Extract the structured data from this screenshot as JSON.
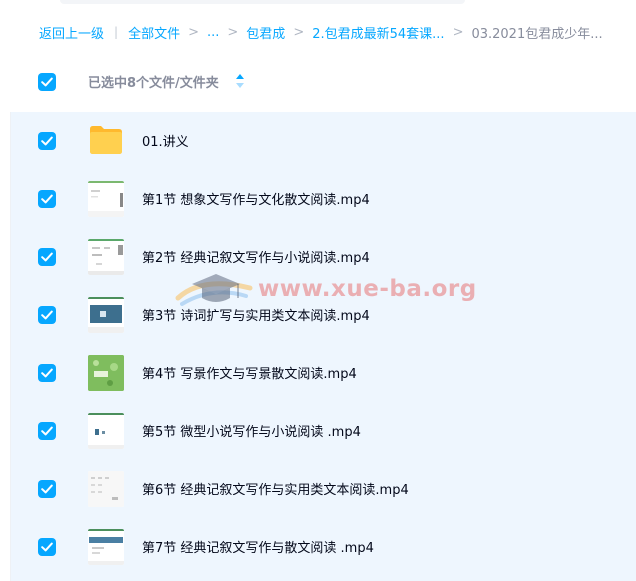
{
  "breadcrumb": {
    "back": "返回上一级",
    "all_files": "全部文件",
    "ellipsis": "...",
    "folder1": "包君成",
    "folder2": "2.包君成最新54套课...",
    "current": "03.2021包君成少年..."
  },
  "header": {
    "selection_label": "已选中8个文件/文件夹"
  },
  "files": [
    {
      "name": "01.讲义",
      "type": "folder"
    },
    {
      "name": "第1节 想象文写作与文化散文阅读.mp4",
      "type": "video"
    },
    {
      "name": "第2节 经典记叙文写作与小说阅读.mp4",
      "type": "video"
    },
    {
      "name": "第3节 诗词扩写与实用类文本阅读.mp4",
      "type": "video"
    },
    {
      "name": "第4节 写景作文与写景散文阅读.mp4",
      "type": "video"
    },
    {
      "name": "第5节 微型小说写作与小说阅读 .mp4",
      "type": "video"
    },
    {
      "name": "第6节 经典记叙文写作与实用类文本阅读.mp4",
      "type": "video"
    },
    {
      "name": "第7节 经典记叙文写作与散文阅读 .mp4",
      "type": "video"
    }
  ],
  "watermark": {
    "text": "www.xue-ba.org",
    "icon": "graduation-cap-logo"
  },
  "colors": {
    "accent": "#06a7ff",
    "selected_row_bg": "#eef6fe",
    "folder_yellow": "#ffc93d",
    "text_primary": "#03081a",
    "text_muted": "#878c9c"
  }
}
